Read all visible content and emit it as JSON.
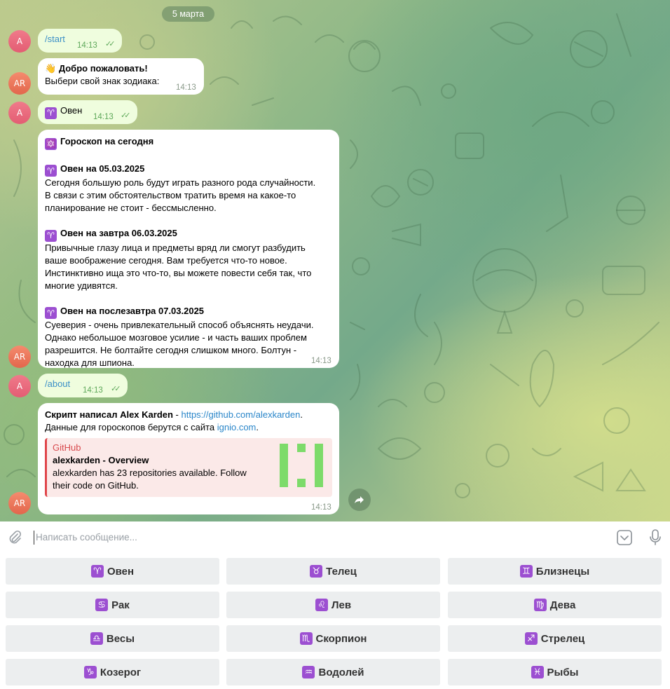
{
  "date_chip": "5 марта",
  "avatars": {
    "user": "A",
    "bot": "AR"
  },
  "messages": {
    "start": {
      "text": "/start",
      "time": "14:13"
    },
    "welcome": {
      "emoji": "👋",
      "title": "Добро пожаловать!",
      "text": "Выбери свой знак зодиака:",
      "time": "14:13"
    },
    "oven": {
      "icon": "♈",
      "text": "Овен",
      "time": "14:13"
    },
    "horoscope": {
      "header_icon": "🔯",
      "header": "Гороскоп на сегодня",
      "sections": [
        {
          "icon": "♈",
          "title": "Овен на 05.03.2025",
          "lines": [
            "Сегодня большую роль будут играть разного рода случайности.",
            "В связи с этим обстоятельством тратить время на какое-то",
            "планирование не стоит - бессмысленно."
          ]
        },
        {
          "icon": "♈",
          "title": "Овен на завтра 06.03.2025",
          "lines": [
            "Привычные глазу лица и предметы вряд ли смогут разбудить",
            "ваше воображение сегодня. Вам требуется что-то новое.",
            "Инстинктивно ища это что-то, вы можете повести себя так, что",
            "многие удивятся."
          ]
        },
        {
          "icon": "♈",
          "title": "Овен на послезавтра 07.03.2025",
          "lines": [
            "Суеверия - очень привлекательный способ объяснять неудачи.",
            "Однако небольшое мозговое усилие - и часть ваших проблем",
            "разрешится. Не болтайте сегодня слишком много. Болтун -",
            "находка для шпиона."
          ]
        }
      ],
      "time": "14:13"
    },
    "about": {
      "text": "/about",
      "time": "14:13"
    },
    "credits": {
      "bold": "Скрипт написал Alex Karden",
      "sep": " - ",
      "link": "https://github.com/alexkarden",
      "dot": ".",
      "line2_prefix": "Данные для гороскопов берутся с сайта ",
      "line2_link": "ignio.com",
      "line2_suffix": ".",
      "preview": {
        "site": "GitHub",
        "title": "alexkarden - Overview",
        "desc_lines": [
          "alexkarden has 23 repositories available. Follow",
          "their code on GitHub."
        ]
      },
      "time": "14:13"
    }
  },
  "input": {
    "placeholder": "Написать сообщение..."
  },
  "keyboard": [
    {
      "icon": "♈",
      "label": "Овен"
    },
    {
      "icon": "♉",
      "label": "Телец"
    },
    {
      "icon": "♊",
      "label": "Близнецы"
    },
    {
      "icon": "♋",
      "label": "Рак"
    },
    {
      "icon": "♌",
      "label": "Лев"
    },
    {
      "icon": "♍",
      "label": "Дева"
    },
    {
      "icon": "♎",
      "label": "Весы"
    },
    {
      "icon": "♏",
      "label": "Скорпион"
    },
    {
      "icon": "♐",
      "label": "Стрелец"
    },
    {
      "icon": "♑",
      "label": "Козерог"
    },
    {
      "icon": "♒",
      "label": "Водолей"
    },
    {
      "icon": "♓",
      "label": "Рыбы"
    }
  ],
  "colors": {
    "outgoing_bubble": "#effdde",
    "incoming_bubble": "#ffffff",
    "link": "#2a86c9",
    "zodiac_badge": "#9c4fd1",
    "check_marks": "#5ea85a",
    "preview_accent": "#e0474c"
  }
}
